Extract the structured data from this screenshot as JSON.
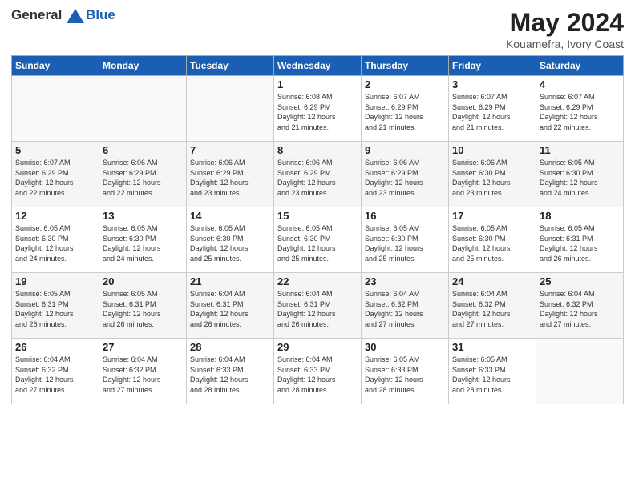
{
  "header": {
    "logo_line1": "General",
    "logo_line2": "Blue",
    "title": "May 2024",
    "subtitle": "Kouamefra, Ivory Coast"
  },
  "weekdays": [
    "Sunday",
    "Monday",
    "Tuesday",
    "Wednesday",
    "Thursday",
    "Friday",
    "Saturday"
  ],
  "weeks": [
    [
      {
        "day": "",
        "info": ""
      },
      {
        "day": "",
        "info": ""
      },
      {
        "day": "",
        "info": ""
      },
      {
        "day": "1",
        "info": "Sunrise: 6:08 AM\nSunset: 6:29 PM\nDaylight: 12 hours\nand 21 minutes."
      },
      {
        "day": "2",
        "info": "Sunrise: 6:07 AM\nSunset: 6:29 PM\nDaylight: 12 hours\nand 21 minutes."
      },
      {
        "day": "3",
        "info": "Sunrise: 6:07 AM\nSunset: 6:29 PM\nDaylight: 12 hours\nand 21 minutes."
      },
      {
        "day": "4",
        "info": "Sunrise: 6:07 AM\nSunset: 6:29 PM\nDaylight: 12 hours\nand 22 minutes."
      }
    ],
    [
      {
        "day": "5",
        "info": "Sunrise: 6:07 AM\nSunset: 6:29 PM\nDaylight: 12 hours\nand 22 minutes."
      },
      {
        "day": "6",
        "info": "Sunrise: 6:06 AM\nSunset: 6:29 PM\nDaylight: 12 hours\nand 22 minutes."
      },
      {
        "day": "7",
        "info": "Sunrise: 6:06 AM\nSunset: 6:29 PM\nDaylight: 12 hours\nand 23 minutes."
      },
      {
        "day": "8",
        "info": "Sunrise: 6:06 AM\nSunset: 6:29 PM\nDaylight: 12 hours\nand 23 minutes."
      },
      {
        "day": "9",
        "info": "Sunrise: 6:06 AM\nSunset: 6:29 PM\nDaylight: 12 hours\nand 23 minutes."
      },
      {
        "day": "10",
        "info": "Sunrise: 6:06 AM\nSunset: 6:30 PM\nDaylight: 12 hours\nand 23 minutes."
      },
      {
        "day": "11",
        "info": "Sunrise: 6:05 AM\nSunset: 6:30 PM\nDaylight: 12 hours\nand 24 minutes."
      }
    ],
    [
      {
        "day": "12",
        "info": "Sunrise: 6:05 AM\nSunset: 6:30 PM\nDaylight: 12 hours\nand 24 minutes."
      },
      {
        "day": "13",
        "info": "Sunrise: 6:05 AM\nSunset: 6:30 PM\nDaylight: 12 hours\nand 24 minutes."
      },
      {
        "day": "14",
        "info": "Sunrise: 6:05 AM\nSunset: 6:30 PM\nDaylight: 12 hours\nand 25 minutes."
      },
      {
        "day": "15",
        "info": "Sunrise: 6:05 AM\nSunset: 6:30 PM\nDaylight: 12 hours\nand 25 minutes."
      },
      {
        "day": "16",
        "info": "Sunrise: 6:05 AM\nSunset: 6:30 PM\nDaylight: 12 hours\nand 25 minutes."
      },
      {
        "day": "17",
        "info": "Sunrise: 6:05 AM\nSunset: 6:30 PM\nDaylight: 12 hours\nand 25 minutes."
      },
      {
        "day": "18",
        "info": "Sunrise: 6:05 AM\nSunset: 6:31 PM\nDaylight: 12 hours\nand 26 minutes."
      }
    ],
    [
      {
        "day": "19",
        "info": "Sunrise: 6:05 AM\nSunset: 6:31 PM\nDaylight: 12 hours\nand 26 minutes."
      },
      {
        "day": "20",
        "info": "Sunrise: 6:05 AM\nSunset: 6:31 PM\nDaylight: 12 hours\nand 26 minutes."
      },
      {
        "day": "21",
        "info": "Sunrise: 6:04 AM\nSunset: 6:31 PM\nDaylight: 12 hours\nand 26 minutes."
      },
      {
        "day": "22",
        "info": "Sunrise: 6:04 AM\nSunset: 6:31 PM\nDaylight: 12 hours\nand 26 minutes."
      },
      {
        "day": "23",
        "info": "Sunrise: 6:04 AM\nSunset: 6:32 PM\nDaylight: 12 hours\nand 27 minutes."
      },
      {
        "day": "24",
        "info": "Sunrise: 6:04 AM\nSunset: 6:32 PM\nDaylight: 12 hours\nand 27 minutes."
      },
      {
        "day": "25",
        "info": "Sunrise: 6:04 AM\nSunset: 6:32 PM\nDaylight: 12 hours\nand 27 minutes."
      }
    ],
    [
      {
        "day": "26",
        "info": "Sunrise: 6:04 AM\nSunset: 6:32 PM\nDaylight: 12 hours\nand 27 minutes."
      },
      {
        "day": "27",
        "info": "Sunrise: 6:04 AM\nSunset: 6:32 PM\nDaylight: 12 hours\nand 27 minutes."
      },
      {
        "day": "28",
        "info": "Sunrise: 6:04 AM\nSunset: 6:33 PM\nDaylight: 12 hours\nand 28 minutes."
      },
      {
        "day": "29",
        "info": "Sunrise: 6:04 AM\nSunset: 6:33 PM\nDaylight: 12 hours\nand 28 minutes."
      },
      {
        "day": "30",
        "info": "Sunrise: 6:05 AM\nSunset: 6:33 PM\nDaylight: 12 hours\nand 28 minutes."
      },
      {
        "day": "31",
        "info": "Sunrise: 6:05 AM\nSunset: 6:33 PM\nDaylight: 12 hours\nand 28 minutes."
      },
      {
        "day": "",
        "info": ""
      }
    ]
  ]
}
